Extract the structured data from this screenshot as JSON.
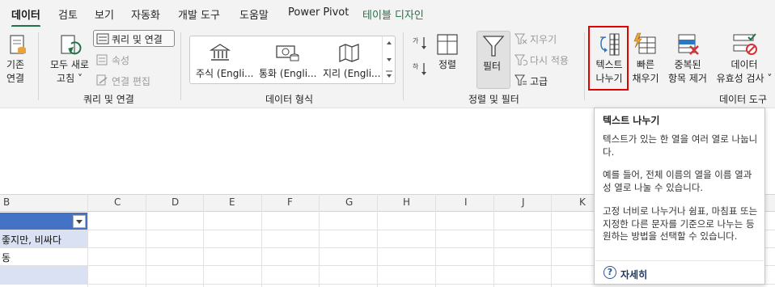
{
  "tabs": [
    {
      "label": "데이터",
      "active": true
    },
    {
      "label": "검토"
    },
    {
      "label": "보기"
    },
    {
      "label": "자동화"
    },
    {
      "label": "개발 도구"
    },
    {
      "label": "도움말"
    },
    {
      "label": "Power Pivot"
    },
    {
      "label": "테이블 디자인",
      "color": "#217346"
    }
  ],
  "ribbon": {
    "existing_connections": {
      "line1": "기존",
      "line2": "연결"
    },
    "refresh_all": {
      "line1": "모두 새로",
      "line2": "고침 ˅"
    },
    "queries_connections": "쿼리 및 연결",
    "properties": "속성",
    "edit_links": "연결 편집",
    "group_queries": "쿼리 및 연결",
    "data_types": {
      "stocks": "주식 (Engli...",
      "currencies": "통화 (Engli...",
      "geography": "지리 (Engli..."
    },
    "group_data_types": "데이터 형식",
    "sort": "정렬",
    "filter": "필터",
    "clear": "지우기",
    "reapply": "다시 적용",
    "advanced": "고급",
    "group_sort_filter": "정렬 및 필터",
    "text_to_columns": {
      "line1": "텍스트",
      "line2": "나누기"
    },
    "flash_fill": {
      "line1": "빠른",
      "line2": "채우기"
    },
    "remove_duplicates": {
      "line1": "중복된",
      "line2": "항목 제거"
    },
    "data_validation": {
      "line1": "데이터",
      "line2": "유효성 검사 ˅"
    },
    "group_data_tools": "데이터 도구",
    "accent_color": "#217346",
    "highlight_color": "#e30000"
  },
  "columns": [
    "B",
    "C",
    "D",
    "E",
    "F",
    "G",
    "H",
    "I",
    "J",
    "K"
  ],
  "cells": {
    "row2": "좋지만, 비싸다",
    "row3": "동"
  },
  "tooltip": {
    "title": "텍스트 나누기",
    "para1": "텍스트가 있는 한 열을 여러 열로 나눕니다.",
    "para2": "예를 들어, 전체 이름의 열을 이름 열과 성 열로 나눌 수 있습니다.",
    "para3": "고정 너비로 나누거나 쉼표, 마침표 또는 지정한 다른 문자를 기준으로 나누는 등 원하는 방법을 선택할 수 있습니다.",
    "help": "자세히",
    "help_icon": "question-icon"
  }
}
